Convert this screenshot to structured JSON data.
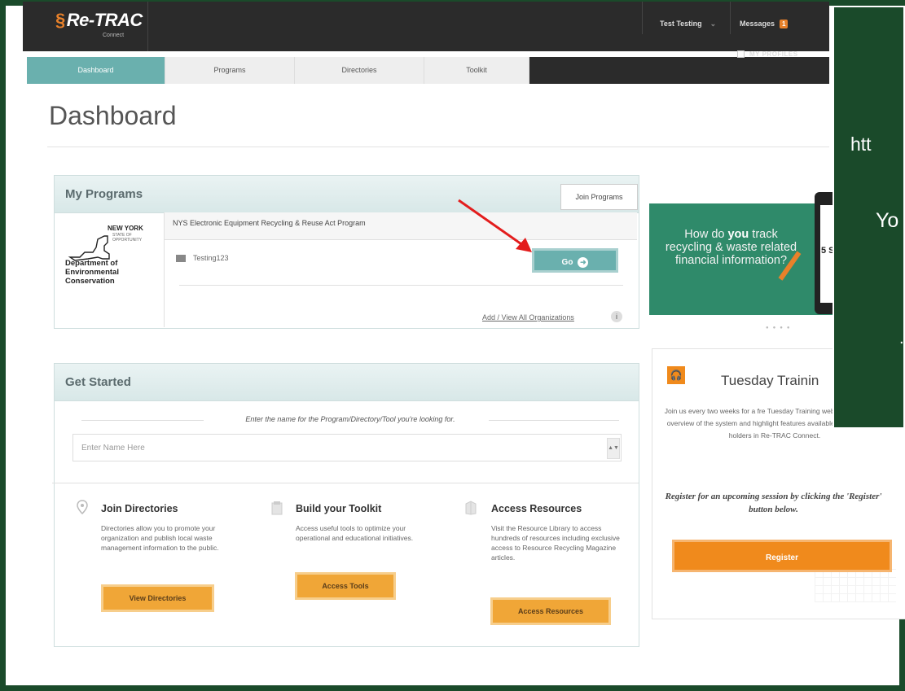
{
  "header": {
    "logo": "Re-TRAC",
    "logo_sub": "Connect",
    "user_name": "Test Testing",
    "messages_label": "Messages",
    "messages_count": "1",
    "my_profiles": "MY PROFILES"
  },
  "tabs": [
    {
      "label": "Dashboard",
      "active": true
    },
    {
      "label": "Programs",
      "active": false
    },
    {
      "label": "Directories",
      "active": false
    },
    {
      "label": "Toolkit",
      "active": false
    }
  ],
  "page_title": "Dashboard",
  "my_programs": {
    "title": "My Programs",
    "join_button": "Join Programs",
    "org_logo": {
      "state": "NEW YORK",
      "sub": "STATE OF OPPORTUNITY",
      "dept": "Department of Environmental Conservation"
    },
    "program_name": "NYS Electronic Equipment Recycling & Reuse Act Program",
    "org_user": "Testing123",
    "go_button": "Go",
    "add_view_link": "Add / View All Organizations"
  },
  "get_started": {
    "title": "Get Started",
    "search_hint": "Enter the name for the Program/Directory/Tool you're looking for.",
    "search_placeholder": "Enter Name Here",
    "features": [
      {
        "title": "Join Directories",
        "text": "Directories allow you to promote your organization and publish local waste management information to the public.",
        "button": "View Directories",
        "icon": "map-pin-icon"
      },
      {
        "title": "Build your Toolkit",
        "text": "Access useful tools to optimize your operational and educational initiatives.",
        "button": "Access Tools",
        "icon": "toolkit-icon"
      },
      {
        "title": "Access Resources",
        "text": "Visit the Resource Library to access hundreds of resources including exclusive access to Resource Recycling Magazine articles.",
        "button": "Access Resources",
        "icon": "library-icon"
      }
    ]
  },
  "promo": {
    "text_pre": "How do ",
    "text_bold": "you",
    "text_post": " track recycling & waste related financial information?",
    "tablet_text": "5 S"
  },
  "training": {
    "title": "Tuesday Trainin",
    "text": "Join us every two weeks for a fre Tuesday Training webinar. This ses an overview of the system and highlight features available to free account holders in Re-TRAC Connect.",
    "cta": "Register for an upcoming session by clicking the 'Register' button below.",
    "register_button": "Register"
  },
  "overlay": {
    "line1": "htt",
    "line2": "Yo",
    "line3": "."
  },
  "colors": {
    "teal": "#6ab0ae",
    "orange": "#f08a1c",
    "dark_green": "#1a4a2a",
    "promo_green": "#2f8a6a"
  }
}
